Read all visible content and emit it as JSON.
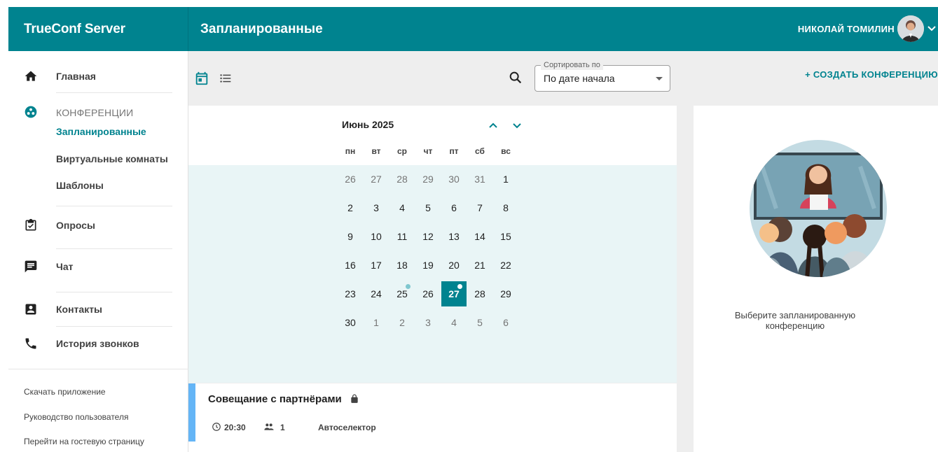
{
  "header": {
    "brand": "TrueConf Server",
    "page_title": "Запланированные",
    "user_name": "НИКОЛАЙ ТОМИЛИН"
  },
  "sidebar": {
    "home": "Главная",
    "conferences_group": "КОНФЕРЕНЦИИ",
    "sub_items": [
      "Запланированные",
      "Виртуальные комнаты",
      "Шаблоны"
    ],
    "polls": "Опросы",
    "chat": "Чат",
    "contacts": "Контакты",
    "call_history": "История звонков",
    "footer_links": [
      "Скачать приложение",
      "Руководство пользователя",
      "Перейти на гостевую страницу"
    ]
  },
  "toolbar": {
    "sort_label": "Сортировать по",
    "sort_value": "По дате начала",
    "create_button": "+ СОЗДАТЬ КОНФЕРЕНЦИЮ"
  },
  "calendar": {
    "month_title": "Июнь 2025",
    "weekdays": [
      "пн",
      "вт",
      "ср",
      "чт",
      "пт",
      "сб",
      "вс"
    ],
    "weeks": [
      [
        "26",
        "27",
        "28",
        "29",
        "30",
        "31",
        "1"
      ],
      [
        "2",
        "3",
        "4",
        "5",
        "6",
        "7",
        "8"
      ],
      [
        "9",
        "10",
        "11",
        "12",
        "13",
        "14",
        "15"
      ],
      [
        "16",
        "17",
        "18",
        "19",
        "20",
        "21",
        "22"
      ],
      [
        "23",
        "24",
        "25",
        "26",
        "27",
        "28",
        "29"
      ],
      [
        "30",
        "1",
        "2",
        "3",
        "4",
        "5",
        "6"
      ]
    ],
    "selected_day": "27",
    "event_days": [
      "25",
      "27"
    ],
    "accent_color": "#00838f"
  },
  "event": {
    "title": "Совещание с партнёрами",
    "time": "20:30",
    "participants": "1",
    "mode": "Автоселектор",
    "bar_color": "#64b5f6"
  },
  "details": {
    "hint": "Выберите запланированную конференцию"
  },
  "colors": {
    "header": "#00838f",
    "accent": "#00838f",
    "background": "#eeeeee"
  }
}
